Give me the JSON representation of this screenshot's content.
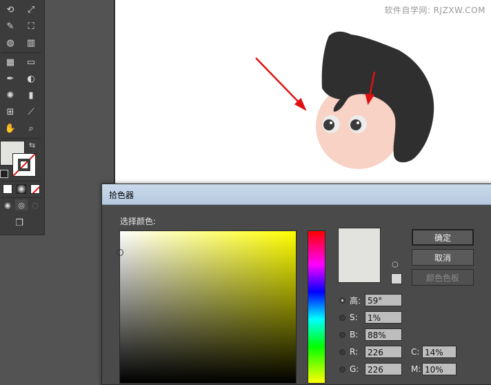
{
  "watermark": "软件自学网: RJZXW.COM",
  "dialog": {
    "title": "拾色器",
    "select_label": "选择颜色:",
    "buttons": {
      "ok": "确定",
      "cancel": "取消",
      "swatches": "颜色色板"
    },
    "hsb": [
      {
        "label": "高:",
        "value": "59°",
        "selected": true
      },
      {
        "label": "S:",
        "value": "1%",
        "selected": false
      },
      {
        "label": "B:",
        "value": "88%",
        "selected": false
      }
    ],
    "rgb": [
      {
        "label": "R:",
        "value": "226"
      },
      {
        "label": "G:",
        "value": "226"
      }
    ],
    "cmyk": [
      {
        "label": "C:",
        "value": "14%"
      },
      {
        "label": "M:",
        "value": "10%"
      }
    ],
    "current_color": "#e2e2df"
  },
  "tools": {
    "fill_color": "#e2e2df"
  }
}
